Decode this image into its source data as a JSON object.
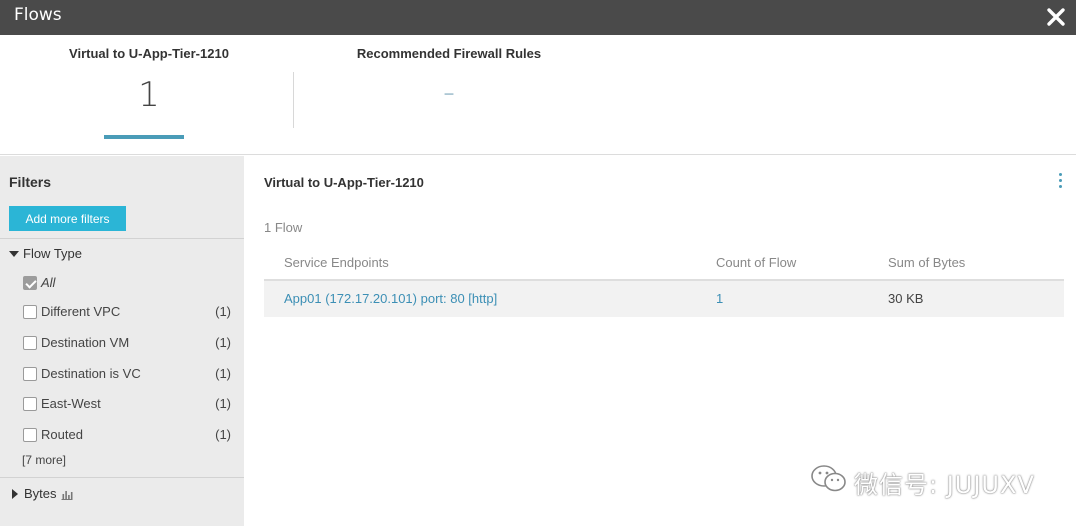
{
  "window": {
    "title": "Flows"
  },
  "summary": {
    "card1": {
      "label": "Virtual to U-App-Tier-1210",
      "value": "1"
    },
    "card2": {
      "label": "Recommended Firewall Rules",
      "value": "–"
    }
  },
  "sidebar": {
    "heading": "Filters",
    "add_filters_label": "Add more filters",
    "flow_type": {
      "label": "Flow Type",
      "items": [
        {
          "label": "All",
          "count": "",
          "checked": true
        },
        {
          "label": "Different VPC",
          "count": "(1)",
          "checked": false
        },
        {
          "label": "Destination VM",
          "count": "(1)",
          "checked": false
        },
        {
          "label": "Destination is VC",
          "count": "(1)",
          "checked": false
        },
        {
          "label": "East-West",
          "count": "(1)",
          "checked": false
        },
        {
          "label": "Routed",
          "count": "(1)",
          "checked": false
        }
      ],
      "more_label": "[7 more]"
    },
    "bytes": {
      "label": "Bytes",
      "icon": "bar-chart-icon"
    }
  },
  "main": {
    "heading": "Virtual to U-App-Tier-1210",
    "flow_count": "1 Flow",
    "table": {
      "headers": [
        "Service Endpoints",
        "Count of Flow",
        "Sum of Bytes"
      ],
      "rows": [
        {
          "endpoint": "App01 (172.17.20.101) port: 80 [http]",
          "count": "1",
          "bytes": "30 KB"
        }
      ]
    }
  },
  "watermark": {
    "text": "微信号: JUJUXV",
    "icon": "wechat-icon"
  },
  "colors": {
    "titlebar": "#4a4a4a",
    "accent": "#2bb5d6",
    "link": "#3c8fb5",
    "underline": "#4a9cb8"
  }
}
